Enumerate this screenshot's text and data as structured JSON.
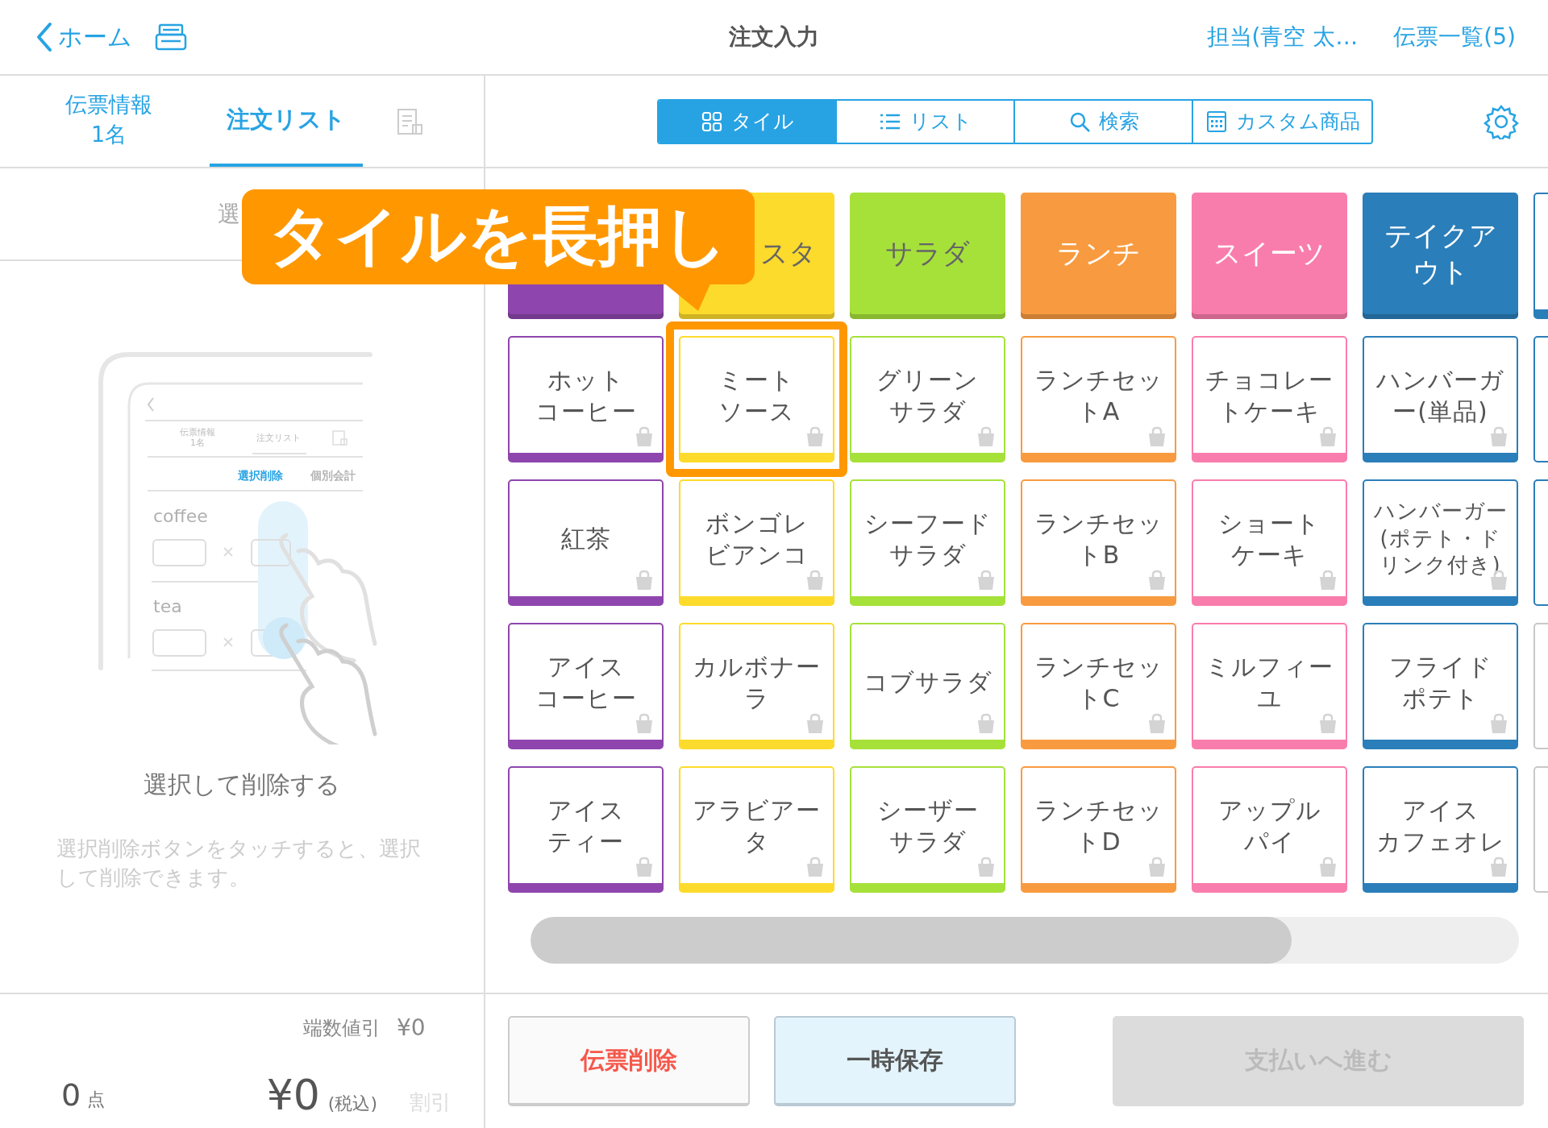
{
  "header": {
    "back": "ホーム",
    "title": "注文入力",
    "staff": "担当(青空 太…",
    "slips": "伝票一覧(5)"
  },
  "left_tabs": [
    {
      "lines": [
        "伝票情報",
        "1名"
      ],
      "selected": false
    },
    {
      "lines": [
        "注文リスト"
      ],
      "selected": true
    }
  ],
  "left_toolbar": {
    "text": "選"
  },
  "illustration": {
    "tabs": [
      [
        "伝票情報",
        "1名"
      ],
      [
        "注文リスト"
      ]
    ],
    "actions": [
      {
        "label": "選択削除",
        "selected": true
      },
      {
        "label": "個別会計",
        "selected": false
      }
    ],
    "rows": [
      "coffee",
      "tea"
    ]
  },
  "hint": {
    "title": "選択して削除する",
    "body": "選択削除ボタンをタッチすると、選択して削除できます。"
  },
  "view_tabs": [
    {
      "label": "タイル",
      "selected": true
    },
    {
      "label": "リスト",
      "selected": false
    },
    {
      "label": "検索",
      "selected": false
    },
    {
      "label": "カスタム商品",
      "selected": false
    }
  ],
  "columns": [
    {
      "color": "#8e46ae",
      "items": [
        {
          "lines": [
            "ホット",
            "コーヒー"
          ],
          "highlighted": false
        },
        {
          "lines": [
            "紅茶"
          ],
          "highlighted": false
        },
        {
          "lines": [
            "アイス",
            "コーヒー"
          ],
          "highlighted": false
        },
        {
          "lines": [
            "アイス",
            "ティー"
          ],
          "highlighted": false
        }
      ]
    },
    {
      "color": "#fddb2c",
      "category": {
        "lines": [
          "スタ"
        ],
        "cut": true
      },
      "items": [
        {
          "lines": [
            "ミート",
            "ソース"
          ],
          "highlighted": true
        },
        {
          "lines": [
            "ボンゴレ",
            "ビアンコ"
          ],
          "highlighted": false
        },
        {
          "lines": [
            "カルボナー",
            "ラ"
          ],
          "highlighted": false
        },
        {
          "lines": [
            "アラビアー",
            "タ"
          ],
          "highlighted": false
        }
      ]
    },
    {
      "color": "#a6e13a",
      "category": {
        "lines": [
          "サラダ"
        ],
        "cut": false
      },
      "items": [
        {
          "lines": [
            "グリーン",
            "サラダ"
          ],
          "highlighted": false
        },
        {
          "lines": [
            "シーフード",
            "サラダ"
          ],
          "highlighted": false
        },
        {
          "lines": [
            "コブサラダ"
          ],
          "highlighted": false
        },
        {
          "lines": [
            "シーザー",
            "サラダ"
          ],
          "highlighted": false
        }
      ]
    },
    {
      "color": "#f89b40",
      "category": {
        "lines": [
          "ランチ"
        ],
        "cut": false
      },
      "items": [
        {
          "lines": [
            "ランチセッ",
            "トA"
          ],
          "highlighted": false
        },
        {
          "lines": [
            "ランチセッ",
            "トB"
          ],
          "highlighted": false
        },
        {
          "lines": [
            "ランチセッ",
            "トC"
          ],
          "highlighted": false
        },
        {
          "lines": [
            "ランチセッ",
            "トD"
          ],
          "highlighted": false
        }
      ]
    },
    {
      "color": "#f97dac",
      "category": {
        "lines": [
          "スイーツ"
        ],
        "cut": false
      },
      "items": [
        {
          "lines": [
            "チョコレー",
            "トケーキ"
          ],
          "highlighted": false
        },
        {
          "lines": [
            "ショート",
            "ケーキ"
          ],
          "highlighted": false
        },
        {
          "lines": [
            "ミルフィー",
            "ユ"
          ],
          "highlighted": false
        },
        {
          "lines": [
            "アップル",
            "パイ"
          ],
          "highlighted": false
        }
      ]
    },
    {
      "color": "#2a7eb9",
      "category": {
        "lines": [
          "テイクア",
          "ウト"
        ],
        "cut": false
      },
      "items": [
        {
          "lines": [
            "ハンバーガ",
            "ー(単品)"
          ],
          "highlighted": false
        },
        {
          "lines": [
            "ハンバーガー",
            "(ポテト・ド",
            "リンク付き)"
          ],
          "highlighted": false
        },
        {
          "lines": [
            "フライド",
            "ポテト"
          ],
          "highlighted": false
        },
        {
          "lines": [
            "アイス",
            "カフェオレ"
          ],
          "highlighted": false
        }
      ]
    }
  ],
  "partial_column": [
    {
      "color": "#2a7eb9"
    },
    {
      "color": "#2a7eb9"
    },
    {
      "color": "#2a7eb9"
    },
    {
      "color": "#c8c8c8"
    },
    {
      "color": "#c8c8c8"
    }
  ],
  "callout": {
    "text": "タイルを長押し"
  },
  "summary": {
    "rounding_label": "端数値引",
    "rounding_value": "¥0",
    "count": "0",
    "count_unit": "点",
    "total": "¥0",
    "tax_note": "(税込)",
    "discount": "割引"
  },
  "buttons": [
    {
      "label": "伝票削除",
      "kind": "danger"
    },
    {
      "label": "一時保存",
      "kind": "hold"
    },
    {
      "label": "支払いへ進む",
      "kind": "primary",
      "disabled": true
    }
  ]
}
